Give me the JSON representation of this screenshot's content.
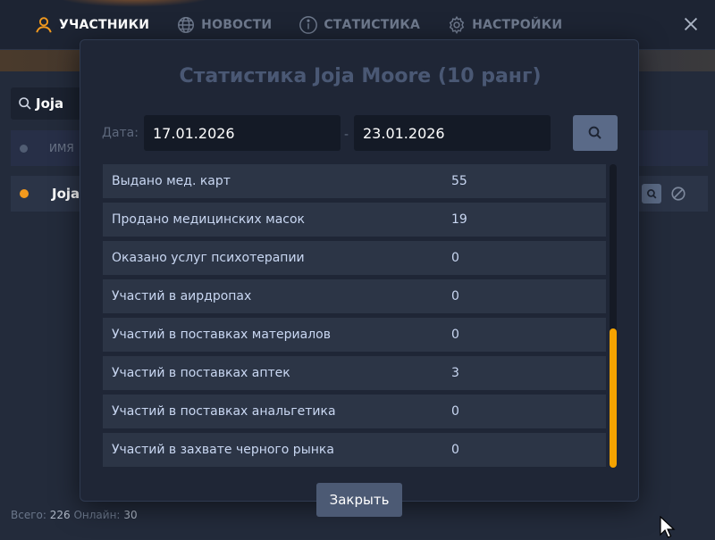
{
  "nav": {
    "items": [
      {
        "label": "УЧАСТНИКИ",
        "icon": "user-icon",
        "active": true
      },
      {
        "label": "НОВОСТИ",
        "icon": "globe-icon",
        "active": false
      },
      {
        "label": "СТАТИСТИКА",
        "icon": "info-icon",
        "active": false
      },
      {
        "label": "НАСТРОЙКИ",
        "icon": "gear-icon",
        "active": false
      }
    ]
  },
  "members": {
    "search_value": "Joja",
    "header_name": "ИМЯ",
    "row_name": "Joja",
    "row_status_color": "#f39a1e"
  },
  "footer": {
    "total_label": "Всего:",
    "total_value": "226",
    "online_label": "Онлайн:",
    "online_value": "30"
  },
  "modal": {
    "title": "Статистика Joja Moore (10 ранг)",
    "date_label": "Дата:",
    "date_from": "17.01.2026",
    "date_separator": "-",
    "date_to": "23.01.2026",
    "close_label": "Закрыть",
    "stats": [
      {
        "label": "Выдано мед. карт",
        "value": "55"
      },
      {
        "label": "Продано медицинских масок",
        "value": "19"
      },
      {
        "label": "Оказано услуг психотерапии",
        "value": "0"
      },
      {
        "label": "Участий в аирдропах",
        "value": "0"
      },
      {
        "label": "Участий в поставках материалов",
        "value": "0"
      },
      {
        "label": "Участий в поставках аптек",
        "value": "3"
      },
      {
        "label": "Участий в поставках анальгетика",
        "value": "0"
      },
      {
        "label": "Участий в захвате черного рынка",
        "value": "0"
      }
    ]
  },
  "colors": {
    "accent": "#f5a300",
    "active_icon": "#f39a1e",
    "panel": "#1f2636"
  }
}
